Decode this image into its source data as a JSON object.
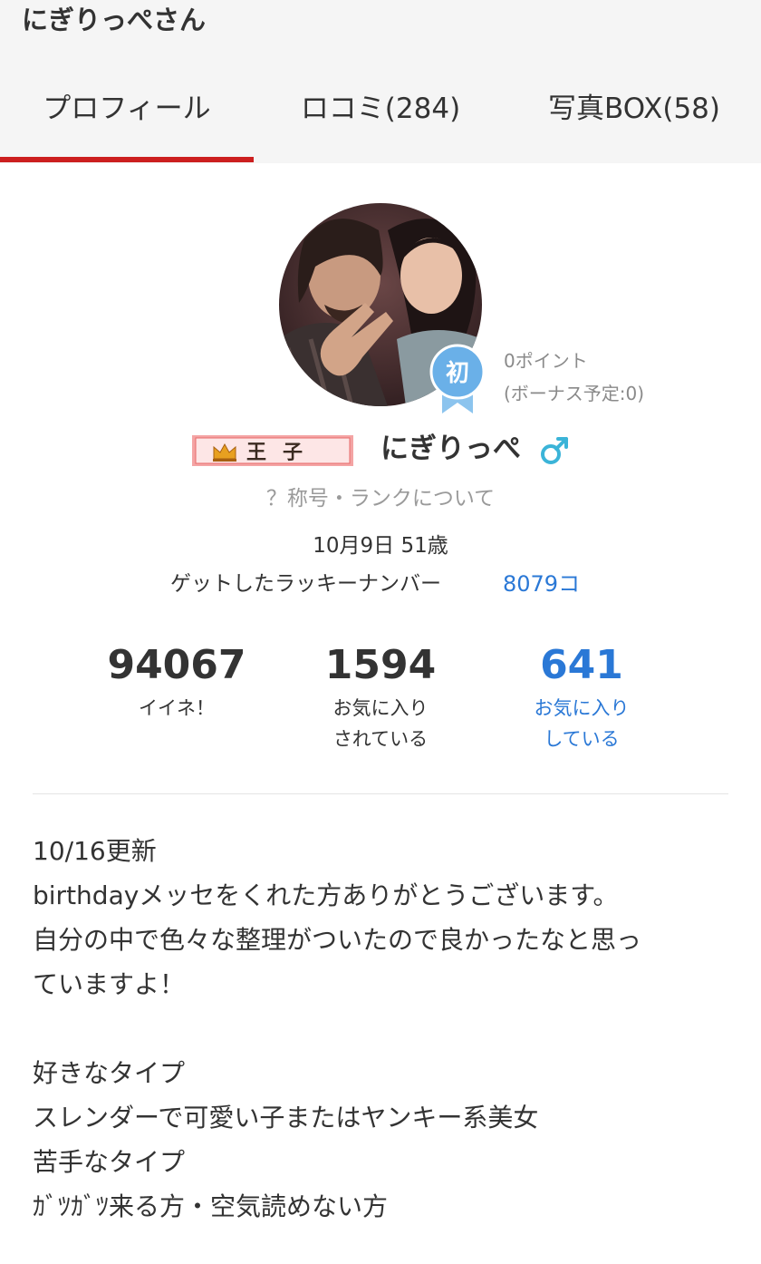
{
  "header": {
    "title": "にぎりっぺさん",
    "tabs": [
      {
        "label": "プロフィール",
        "active": true
      },
      {
        "label": "ロコミ(284)",
        "active": false
      },
      {
        "label": "写真BOX(58)",
        "active": false
      }
    ]
  },
  "profile": {
    "badge_label": "初",
    "points": "0ポイント",
    "bonus": "(ボーナス予定:0)",
    "rank_title": "王子",
    "username": "にぎりっぺ",
    "gender_symbol": "♂",
    "rank_link": "？称号・ランクについて",
    "birthday": "10月9日 51歳",
    "lucky_label": "ゲットしたラッキーナンバー",
    "lucky_value": "8079コ"
  },
  "stats": [
    {
      "value": "94067",
      "label_line1": "イイネ！",
      "label_line2": ""
    },
    {
      "value": "1594",
      "label_line1": "お気に入り",
      "label_line2": "されている"
    },
    {
      "value": "641",
      "label_line1": "お気に入り",
      "label_line2": "している"
    }
  ],
  "bio": {
    "lines": [
      "10/16更新",
      "birthdayメッセをくれた方ありがとうございます。",
      "自分の中で色々な整理がついたので良かったなと思っ",
      "ていますよ！",
      "",
      "好きなタイプ",
      "スレンダーで可愛い子またはヤンキー系美女",
      "苦手なタイプ",
      "ｶﾞﾂｶﾞﾂ来る方・空気読めない方"
    ]
  },
  "colors": {
    "accent_red": "#cc1f1f",
    "link_blue": "#2a78d6",
    "badge_blue": "#6ab0e8",
    "gender_cyan": "#3bb4d8"
  }
}
